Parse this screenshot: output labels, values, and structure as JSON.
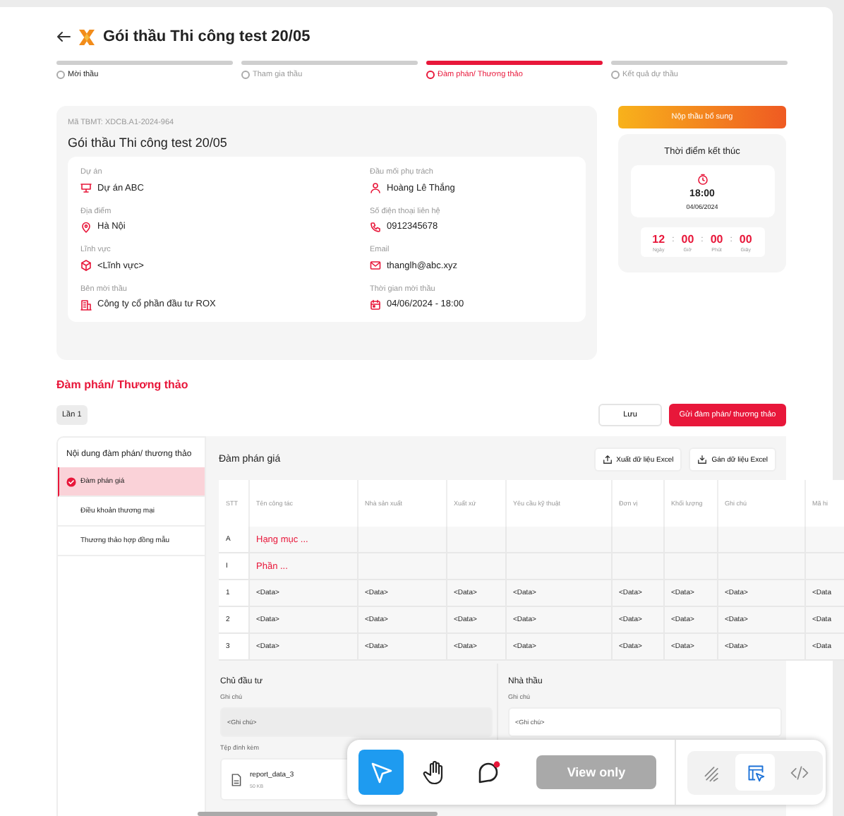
{
  "header": {
    "title": "Gói thầu Thi công test 20/05"
  },
  "steps": [
    {
      "label": "Mời thầu",
      "selected": false,
      "completed": true
    },
    {
      "label": "Tham gia thầu",
      "selected": false,
      "completed": false
    },
    {
      "label": "Đàm phán/ Thương thảo",
      "selected": true,
      "completed": false
    },
    {
      "label": "Kết quả dự thầu",
      "selected": false,
      "completed": false
    }
  ],
  "tender": {
    "code": "Mã TBMT: XDCB.A1-2024-964",
    "title": "Gói thầu Thi công test 20/05",
    "fields": [
      {
        "label": "Dự án",
        "value": "Dự án ABC"
      },
      {
        "label": "Đầu mối phụ trách",
        "value": "Hoàng Lê Thắng"
      },
      {
        "label": "Địa điểm",
        "value": "Hà Nội"
      },
      {
        "label": "Số điện thoại liên hệ",
        "value": "0912345678"
      },
      {
        "label": "Lĩnh vực",
        "value": "<Lĩnh vực>"
      },
      {
        "label": "Email",
        "value": "thanglh@abc.xyz"
      },
      {
        "label": "Bên mời thầu",
        "value": "Công ty cổ phần đầu tư ROX"
      },
      {
        "label": "Thời gian mời thầu",
        "value": "04/06/2024 - 18:00"
      }
    ]
  },
  "submit_button": "Nộp thầu bổ sung",
  "deadline": {
    "title": "Thời điểm kết thúc",
    "time": "18:00",
    "date": "04/06/2024",
    "separator": ":",
    "countdown": [
      {
        "value": "12",
        "unit": "Ngày"
      },
      {
        "value": "00",
        "unit": "Giờ"
      },
      {
        "value": "00",
        "unit": "Phút"
      },
      {
        "value": "00",
        "unit": "Giây"
      }
    ]
  },
  "negotiation": {
    "title": "Đàm phán/ Thương thảo",
    "round": "Lần 1",
    "save_button": "Lưu",
    "send_button": "Gửi đàm phán/ thương thảo",
    "menu": {
      "title": "Nội dung đàm phán/ thương thảo",
      "items": [
        {
          "label": "Đàm phán giá",
          "selected": true
        },
        {
          "label": "Điều khoản thương mại",
          "selected": false
        },
        {
          "label": "Thương thảo hợp đồng mẫu",
          "selected": false
        }
      ]
    },
    "panel": {
      "title": "Đàm phán giá",
      "actions": [
        {
          "label": "Xuất dữ liệu Excel"
        },
        {
          "label": "Gán dữ liệu Excel"
        }
      ]
    },
    "table": {
      "columns": [
        "STT",
        "Tên công tác",
        "Nhà sản xuất",
        "Xuất xứ",
        "Yêu cầu kỹ thuật",
        "Đơn vị",
        "Khối lượng",
        "Ghi chú",
        "Mã hi"
      ],
      "rows": [
        {
          "kind": "group",
          "cells": [
            "A",
            "Hạng mục ..."
          ]
        },
        {
          "kind": "group",
          "cells": [
            "I",
            "Phần ..."
          ]
        },
        {
          "kind": "item",
          "cells": [
            "1",
            "<Data>",
            "<Data>",
            "<Data>",
            "<Data>",
            "<Data>",
            "<Data>",
            "<Data>",
            "<Data"
          ]
        },
        {
          "kind": "item",
          "cells": [
            "2",
            "<Data>",
            "<Data>",
            "<Data>",
            "<Data>",
            "<Data>",
            "<Data>",
            "<Data>",
            "<Data"
          ]
        },
        {
          "kind": "item",
          "cells": [
            "3",
            "<Data>",
            "<Data>",
            "<Data>",
            "<Data>",
            "<Data>",
            "<Data>",
            "<Data>",
            "<Data"
          ]
        }
      ]
    },
    "notes": [
      {
        "title": "Chủ đầu tư",
        "label": "Ghi chú",
        "placeholder": "<Ghi chú>",
        "disabled": true,
        "attachments_label": "Tệp đính kèm",
        "file": {
          "name": "report_data_3",
          "size": "50 KB"
        }
      },
      {
        "title": "Nhà thầu",
        "label": "Ghi chú",
        "placeholder": "<Ghi chú>",
        "disabled": false
      }
    ]
  },
  "toolbar": {
    "tools": [
      {
        "selected": true,
        "badge": false
      },
      {
        "selected": false,
        "badge": false
      },
      {
        "selected": false,
        "badge": true
      }
    ],
    "mode": {
      "label": "View only",
      "disabled": true
    },
    "views": [
      {
        "selected": false
      },
      {
        "selected": true
      },
      {
        "selected": false
      }
    ]
  }
}
